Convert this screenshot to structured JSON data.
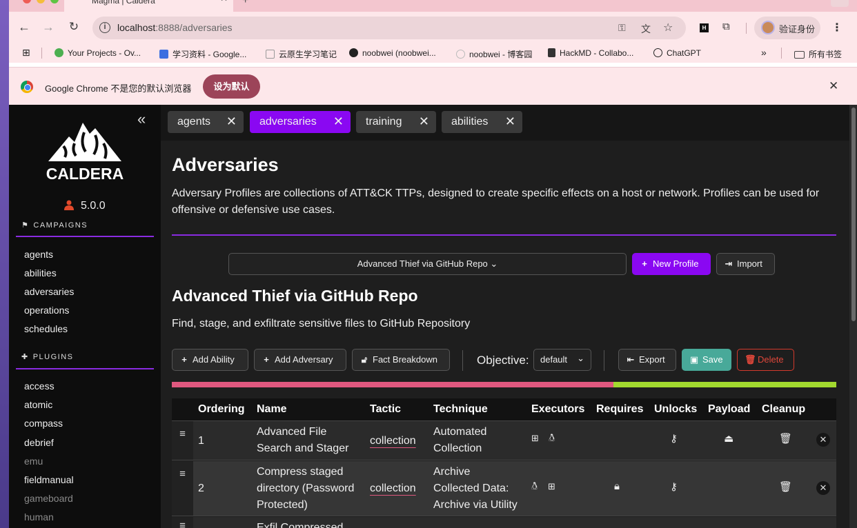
{
  "browser": {
    "tab_title": "Magma | Caldera",
    "url_host": "localhost",
    "url_rest": ":8888/adversaries",
    "profile_label": "验证身份",
    "bookmarks": [
      {
        "label": "Your Projects - Ov...",
        "color": "#4caf50"
      },
      {
        "label": "学习资料 - Google...",
        "color": "#3b6fe0"
      },
      {
        "label": "云原生学习笔记",
        "color": "#999999"
      },
      {
        "label": "noobwei (noobwei...",
        "color": "#222222"
      },
      {
        "label": "noobwei - 博客园",
        "color": "#999999"
      },
      {
        "label": "HackMD - Collabo...",
        "color": "#333333"
      },
      {
        "label": "ChatGPT",
        "color": "#222222"
      }
    ],
    "all_bookmarks": "所有书签",
    "infobar_text": "Google Chrome 不是您的默认浏览器",
    "infobar_button": "设为默认"
  },
  "sidebar": {
    "logo_text": "CALDERA",
    "version": "5.0.0",
    "campaigns_heading": "CAMPAIGNS",
    "campaigns": [
      "agents",
      "abilities",
      "adversaries",
      "operations",
      "schedules"
    ],
    "plugins_heading": "PLUGINS",
    "plugins": [
      {
        "label": "access",
        "dim": false
      },
      {
        "label": "atomic",
        "dim": false
      },
      {
        "label": "compass",
        "dim": false
      },
      {
        "label": "debrief",
        "dim": false
      },
      {
        "label": "emu",
        "dim": true
      },
      {
        "label": "fieldmanual",
        "dim": false
      },
      {
        "label": "gameboard",
        "dim": true
      },
      {
        "label": "human",
        "dim": true
      }
    ]
  },
  "open_tabs": [
    "agents",
    "adversaries",
    "training",
    "abilities"
  ],
  "page": {
    "title": "Adversaries",
    "description": "Adversary Profiles are collections of ATT&CK TTPs, designed to create specific effects on a host or network. Profiles can be used for offensive or defensive use cases.",
    "selected_profile": "Advanced Thief via GitHub Repo",
    "new_profile": "New Profile",
    "import": "Import"
  },
  "adversary": {
    "name": "Advanced Thief via GitHub Repo",
    "description": "Find, stage, and exfiltrate sensitive files to GitHub Repository",
    "add_ability": "Add Ability",
    "add_adversary": "Add Adversary",
    "fact_breakdown": "Fact Breakdown",
    "objective_label": "Objective:",
    "objective_value": "default",
    "export": "Export",
    "save": "Save",
    "delete": "Delete",
    "progress_fraction": 0.665,
    "colors": {
      "pink": "#e0587f",
      "green": "#a2d92f",
      "accent": "#8a08f2"
    }
  },
  "table": {
    "headers": [
      "Ordering",
      "Name",
      "Tactic",
      "Technique",
      "Executors",
      "Requires",
      "Unlocks",
      "Payload",
      "Cleanup"
    ],
    "rows": [
      {
        "ordering": "1",
        "name_lines": [
          "Advanced File",
          "Search and Stager"
        ],
        "tactic": "collection",
        "technique_lines": [
          "Automated",
          "Collection"
        ],
        "executors": [
          "windows-icon",
          "linux-icon"
        ]
      },
      {
        "ordering": "2",
        "name_lines": [
          "Compress staged",
          "directory (Password",
          "Protected)"
        ],
        "tactic": "collection",
        "technique_lines": [
          "Archive",
          "Collected Data:",
          "Archive via Utility"
        ],
        "executors": [
          "linux-icon",
          "windows-icon"
        ]
      },
      {
        "ordering": "",
        "name_lines": [
          "Exfil Compressed"
        ]
      }
    ]
  }
}
